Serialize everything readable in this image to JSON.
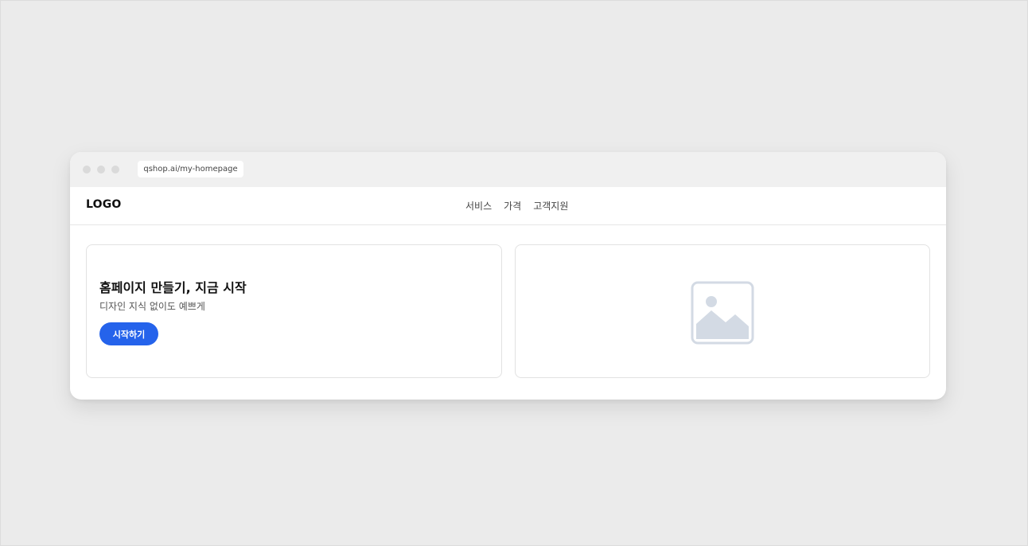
{
  "browser": {
    "url": "qshop.ai/my-homepage"
  },
  "nav": {
    "logo": "LOGO",
    "items": [
      "서비스",
      "가격",
      "고객지원"
    ]
  },
  "hero": {
    "title": "홈페이지 만들기, 지금 시작",
    "subtitle": "디자인 지식 없이도 예쁘게",
    "cta_label": "시작하기"
  },
  "media": {
    "icon": "image-placeholder-icon"
  },
  "colors": {
    "accent": "#2563eb",
    "placeholder_icon": "#d3dae4"
  }
}
